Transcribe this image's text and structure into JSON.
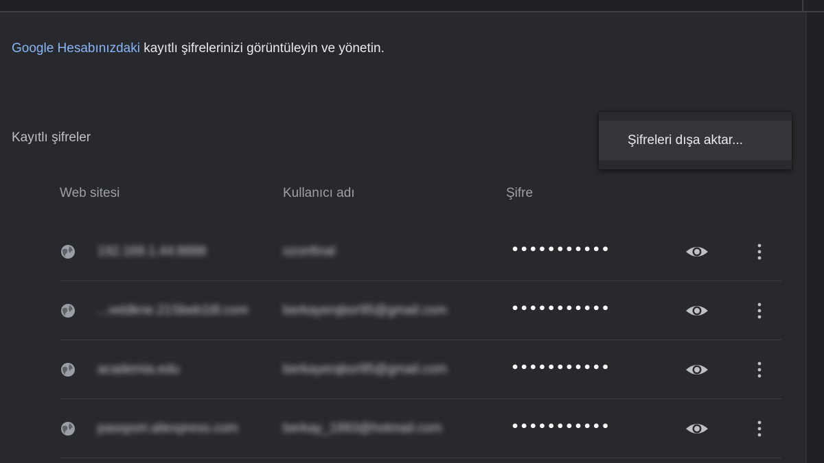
{
  "intro": {
    "link_text": "Google Hesabınızdaki",
    "rest_text": " kayıtlı şifrelerinizi görüntüleyin ve yönetin."
  },
  "section": {
    "title": "Kayıtlı şifreler"
  },
  "menu": {
    "export_label": "Şifreleri dışa aktar..."
  },
  "columns": {
    "website": "Web sitesi",
    "username": "Kullanıcı adı",
    "password": "Şifre"
  },
  "rows": [
    {
      "site": "192.168.1.44:8888",
      "username": "ozonfinal",
      "password": "•••••••••••"
    },
    {
      "site": "...veldkne.21Sbeb1t8.com",
      "username": "berkayerqbor95@gmail.com",
      "password": "•••••••••••"
    },
    {
      "site": "academia.edu",
      "username": "berkayerqbor95@gmail.com",
      "password": "•••••••••••"
    },
    {
      "site": "passport.aliexpress.com",
      "username": "berkay_1993@hotmail.com",
      "password": "•••••••••••"
    }
  ],
  "icons": {
    "row_site": "globe-icon",
    "row_show": "eye-icon",
    "row_more": "more-vert-icon"
  },
  "colors": {
    "background": "#202124",
    "surface": "#28292c",
    "link": "#8ab4f8",
    "text": "#e8eaed",
    "secondary_text": "#9aa0a6"
  }
}
